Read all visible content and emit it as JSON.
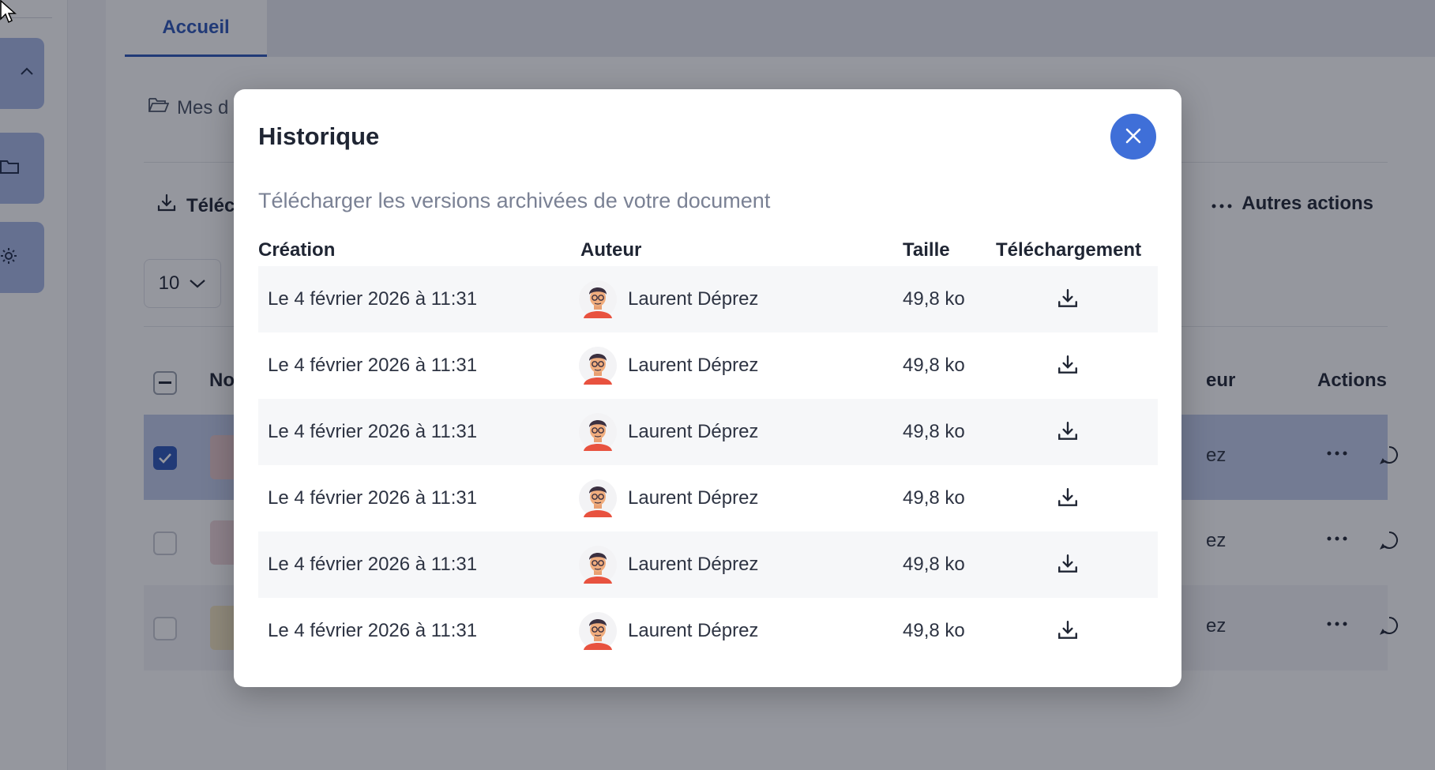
{
  "background": {
    "tab_home": "Accueil",
    "breadcrumb": "Mes d",
    "download_button": "Téléc",
    "more_actions": "Autres actions",
    "page_size": "10",
    "table_header": {
      "name": "No",
      "author": "eur",
      "actions": "Actions"
    },
    "rows": [
      {
        "author": "ez"
      },
      {
        "author": "ez"
      },
      {
        "author": "ez"
      }
    ]
  },
  "modal": {
    "title": "Historique",
    "subtitle": "Télécharger les versions archivées de votre document",
    "columns": {
      "creation": "Création",
      "author": "Auteur",
      "size": "Taille",
      "download": "Téléchargement"
    },
    "rows": [
      {
        "date": "Le 4 février 2026 à 11:31",
        "author": "Laurent Déprez",
        "size": "49,8 ko"
      },
      {
        "date": "Le 4 février 2026 à 11:31",
        "author": "Laurent Déprez",
        "size": "49,8 ko"
      },
      {
        "date": "Le 4 février 2026 à 11:31",
        "author": "Laurent Déprez",
        "size": "49,8 ko"
      },
      {
        "date": "Le 4 février 2026 à 11:31",
        "author": "Laurent Déprez",
        "size": "49,8 ko"
      },
      {
        "date": "Le 4 février 2026 à 11:31",
        "author": "Laurent Déprez",
        "size": "49,8 ko"
      },
      {
        "date": "Le 4 février 2026 à 11:31",
        "author": "Laurent Déprez",
        "size": "49,8 ko"
      }
    ]
  },
  "colors": {
    "accent": "#2c56b8",
    "close_button": "#3f6fd8",
    "selected_row": "#c2ccec"
  },
  "icons": [
    "chevron-up-icon",
    "folder-icon",
    "gear-icon",
    "folder-open-icon",
    "download-icon",
    "more-dots-icon",
    "chevron-down-icon",
    "pdf-icon",
    "document-icon",
    "comment-icon",
    "close-icon",
    "avatar",
    "mouse-cursor-icon"
  ]
}
